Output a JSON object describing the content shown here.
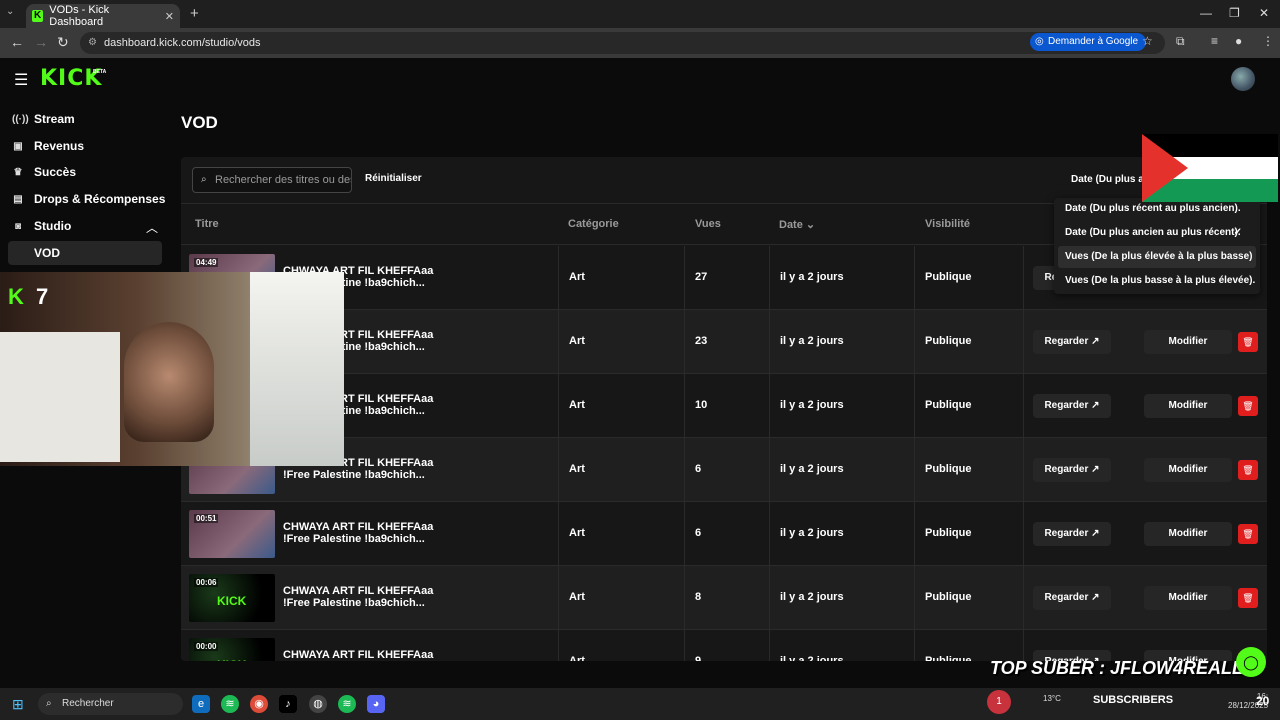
{
  "browser": {
    "tab_title": "VODs - Kick Dashboard",
    "url": "dashboard.kick.com/studio/vods",
    "ask_google": "Demander à Google"
  },
  "app": {
    "logo": "KICK",
    "logo_badge": "BETA"
  },
  "sidebar": {
    "items": [
      {
        "label": "Stream",
        "icon": "broadcast-icon"
      },
      {
        "label": "Revenus",
        "icon": "revenue-icon"
      },
      {
        "label": "Succès",
        "icon": "trophy-icon"
      },
      {
        "label": "Drops & Récompenses",
        "icon": "gift-icon"
      },
      {
        "label": "Studio",
        "icon": "studio-icon"
      }
    ],
    "sub_item": "VOD"
  },
  "page": {
    "title": "VOD"
  },
  "toolbar": {
    "search_placeholder": "Rechercher des titres ou des",
    "reset_label": "Réinitialiser",
    "sort_selected": "Date (Du plus ancien au plus récent)."
  },
  "table": {
    "headers": {
      "title": "Titre",
      "category": "Catégorie",
      "views": "Vues",
      "date": "Date",
      "visibility": "Visibilité"
    },
    "watch_label": "Regarder",
    "edit_label": "Modifier",
    "rows": [
      {
        "duration": "04:49",
        "title1": "CHWAYA ART FIL KHEFFAaa",
        "title2": "!Free Palestine !ba9chich...",
        "category": "Art",
        "views": "27",
        "date": "il y a 2 jours",
        "visibility": "Publique"
      },
      {
        "duration": "",
        "title1": "CHWAYA ART FIL KHEFFAaa",
        "title2": "!Free Palestine !ba9chich...",
        "category": "Art",
        "views": "23",
        "date": "il y a 2 jours",
        "visibility": "Publique"
      },
      {
        "duration": "",
        "title1": "CHWAYA ART FIL KHEFFAaa",
        "title2": "!Free Palestine !ba9chich...",
        "category": "Art",
        "views": "10",
        "date": "il y a 2 jours",
        "visibility": "Publique"
      },
      {
        "duration": "",
        "title1": "CHWAYA ART FIL KHEFFAaa",
        "title2": "!Free Palestine !ba9chich...",
        "category": "Art",
        "views": "6",
        "date": "il y a 2 jours",
        "visibility": "Publique"
      },
      {
        "duration": "00:51",
        "title1": "CHWAYA ART FIL KHEFFAaa",
        "title2": "!Free Palestine !ba9chich...",
        "category": "Art",
        "views": "6",
        "date": "il y a 2 jours",
        "visibility": "Publique"
      },
      {
        "duration": "00:06",
        "title1": "CHWAYA ART FIL KHEFFAaa",
        "title2": "!Free Palestine !ba9chich...",
        "category": "Art",
        "views": "8",
        "date": "il y a 2 jours",
        "visibility": "Publique"
      },
      {
        "duration": "00:00",
        "title1": "CHWAYA ART FIL KHEFFAaa",
        "title2": "",
        "category": "Art",
        "views": "9",
        "date": "il y a 2 jours",
        "visibility": "Publique"
      }
    ]
  },
  "sort_dropdown": {
    "options": [
      "Date (Du plus récent au plus ancien).",
      "Date (Du plus ancien au plus récent).",
      "Vues (De la plus élevée à la plus basse)",
      "Vues (De la plus basse à la plus élevée)."
    ],
    "selected_index": 1,
    "hover_index": 2
  },
  "overlays": {
    "webcam_logo": "K",
    "webcam_count": "7",
    "top_suber": "TOP SUBER : JFLOW4REALLL",
    "subscribers_label": "SUBSCRIBERS",
    "subscribers_count": "20"
  },
  "taskbar": {
    "search_label": "Rechercher",
    "notification_count": "1",
    "weather": "13°C",
    "time": "16:",
    "date": "28/12/2025"
  }
}
